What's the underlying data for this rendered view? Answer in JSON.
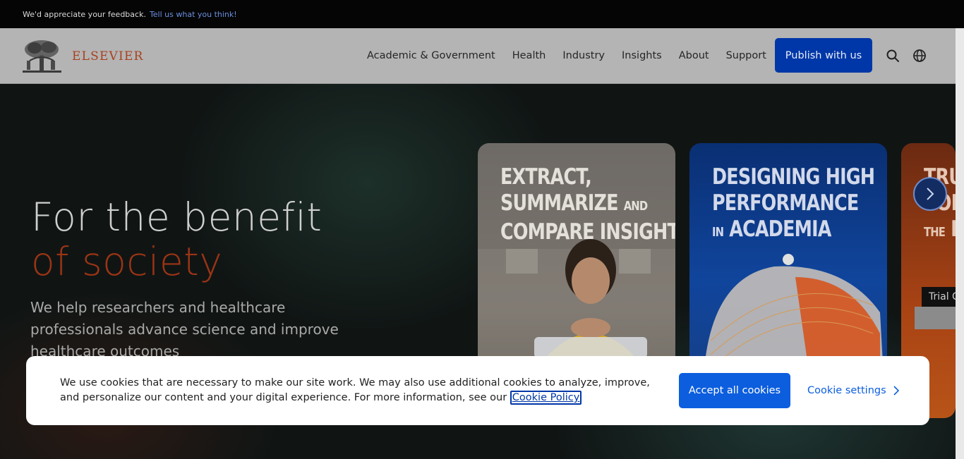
{
  "feedback_bar": {
    "text": "We'd appreciate your feedback.",
    "link": "Tell us what you think!"
  },
  "header": {
    "brand": "ELSEVIER",
    "nav": [
      {
        "label": "Academic & Government"
      },
      {
        "label": "Health"
      },
      {
        "label": "Industry"
      },
      {
        "label": "Insights"
      },
      {
        "label": "About"
      },
      {
        "label": "Support"
      }
    ],
    "publish_label": "Publish with us",
    "icons": [
      "search-icon",
      "globe-icon"
    ]
  },
  "hero": {
    "title_line1": "For the benefit",
    "title_line2": "of society",
    "subtitle": "We help researchers and healthcare professionals advance science and improve healthcare outcomes",
    "cards": [
      {
        "line1": "EXTRACT,",
        "line2": "SUMMARIZE",
        "line2_small": "AND",
        "line3": "COMPARE INSIGHTS"
      },
      {
        "line1": "DESIGNING HIGH",
        "line2": "PERFORMANCE",
        "line3_small": "IN",
        "line3": "ACADEMIA"
      },
      {
        "line1": "TRU",
        "line2": "CON",
        "line3_small": "THE",
        "line3": "P"
      }
    ],
    "trial_tag": "Trial C"
  },
  "cookie_banner": {
    "text": "We use cookies that are necessary to make our site work. We may also use additional cookies to analyze, improve, and personalize our content and your digital experience. For more information, see our",
    "policy_link": "Cookie Policy",
    "accept_label": "Accept all cookies",
    "settings_label": "Cookie settings"
  },
  "colors": {
    "brand_orange": "#a8411e",
    "primary_blue": "#0037a8",
    "accept_blue": "#0c5ede"
  }
}
